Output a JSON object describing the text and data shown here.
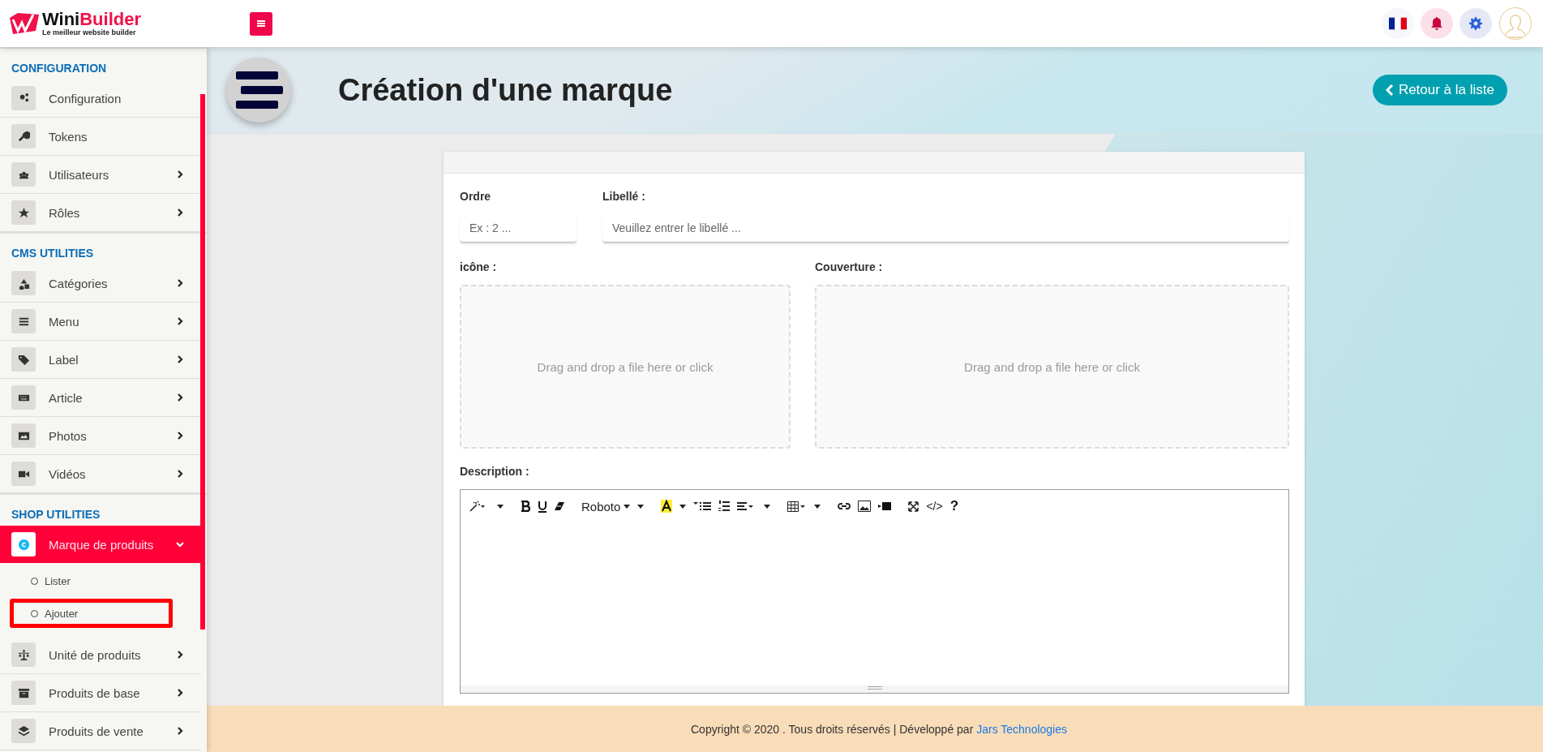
{
  "header": {
    "logo": {
      "name_part1": "Wini",
      "name_part2": "Builder",
      "tagline": "Le meilleur website builder"
    }
  },
  "sidebar": {
    "sections": [
      {
        "title": "CONFIGURATION",
        "items": [
          {
            "label": "Configuration",
            "kind": "link",
            "selected": false
          },
          {
            "label": "Tokens",
            "kind": "link",
            "selected": false
          },
          {
            "label": "Utilisateurs",
            "kind": "group",
            "selected": false,
            "expanded": false
          },
          {
            "label": "Rôles",
            "kind": "group",
            "selected": false,
            "expanded": false
          }
        ]
      },
      {
        "title": "CMS UTILITIES",
        "items": [
          {
            "label": "Catégories",
            "kind": "group",
            "selected": false,
            "expanded": false
          },
          {
            "label": "Menu",
            "kind": "group",
            "selected": false,
            "expanded": false
          },
          {
            "label": "Label",
            "kind": "group",
            "selected": false,
            "expanded": false
          },
          {
            "label": "Article",
            "kind": "group",
            "selected": false,
            "expanded": false
          },
          {
            "label": "Photos",
            "kind": "group",
            "selected": false,
            "expanded": false
          },
          {
            "label": "Vidéos",
            "kind": "group",
            "selected": false,
            "expanded": false
          }
        ]
      },
      {
        "title": "SHOP UTILITIES",
        "items": [
          {
            "label": "Marque de produits",
            "kind": "group",
            "selected": true,
            "expanded": true,
            "children": [
              {
                "label": "Lister",
                "highlighted": false
              },
              {
                "label": "Ajouter",
                "highlighted": true
              }
            ]
          },
          {
            "label": "Unité de produits",
            "kind": "group",
            "selected": false,
            "expanded": false
          },
          {
            "label": "Produits de base",
            "kind": "group",
            "selected": false,
            "expanded": false
          },
          {
            "label": "Produits de vente",
            "kind": "group",
            "selected": false,
            "expanded": false
          }
        ]
      }
    ]
  },
  "page": {
    "title": "Création d'une marque",
    "back_button": "Retour à la liste"
  },
  "form": {
    "order": {
      "label": "Ordre",
      "placeholder": "Ex : 2 ..."
    },
    "name": {
      "label": "Libellé :",
      "placeholder": "Veuillez entrer le libellé ..."
    },
    "icon_upload": {
      "label": "icône :",
      "hint": "Drag and drop a file here or click"
    },
    "cover_upload": {
      "label": "Couverture :",
      "hint": "Drag and drop a file here or click"
    },
    "description": {
      "label": "Description :",
      "toolbar": {
        "font": "Roboto",
        "code": "</>",
        "help": "?"
      }
    }
  },
  "footer": {
    "text": "Copyright © 2020 . Tous droits réservés | Développé par ",
    "link": "Jars Technologies"
  }
}
